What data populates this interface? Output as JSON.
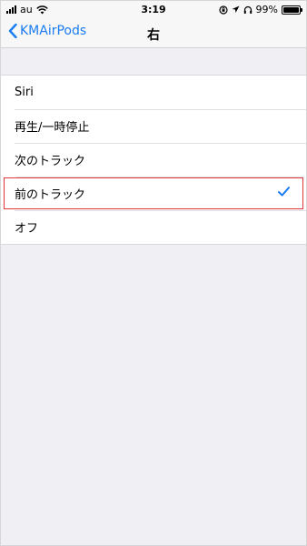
{
  "status_bar": {
    "carrier": "au",
    "time": "3:19",
    "battery": "99%",
    "icons": [
      "signal-icon",
      "wifi-icon",
      "orientation-lock-icon",
      "location-icon",
      "headphones-icon",
      "battery-icon"
    ]
  },
  "nav": {
    "back_label": "KMAirPods",
    "title": "右"
  },
  "options": [
    {
      "label": "Siri",
      "selected": false
    },
    {
      "label": "再生/一時停止",
      "selected": false
    },
    {
      "label": "次のトラック",
      "selected": false
    },
    {
      "label": "前のトラック",
      "selected": true
    },
    {
      "label": "オフ",
      "selected": false
    }
  ],
  "colors": {
    "accent": "#1a7cf2",
    "highlight": "#e0363c",
    "background": "#efeff4"
  }
}
